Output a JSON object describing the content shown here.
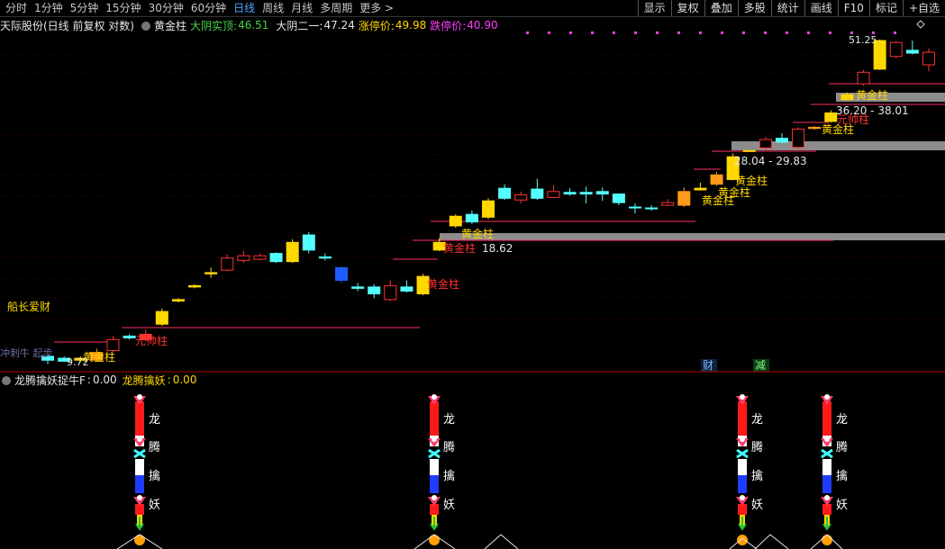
{
  "toolbar": {
    "period_tabs": [
      {
        "label": "分时"
      },
      {
        "label": "1分钟"
      },
      {
        "label": "5分钟"
      },
      {
        "label": "15分钟"
      },
      {
        "label": "30分钟"
      },
      {
        "label": "60分钟"
      },
      {
        "label": "日线"
      },
      {
        "label": "周线"
      },
      {
        "label": "月线"
      },
      {
        "label": "多周期"
      },
      {
        "label": "更多 >"
      }
    ],
    "active_tab": "日线",
    "right_tools": [
      {
        "label": "显示"
      },
      {
        "label": "复权"
      },
      {
        "label": "叠加"
      },
      {
        "label": "多股"
      },
      {
        "label": "统计"
      },
      {
        "label": "画线"
      },
      {
        "label": "F10"
      },
      {
        "label": "标记"
      },
      {
        "label": "+自选"
      }
    ]
  },
  "legend": {
    "stock": "天际股份(日线 前复权 对数)",
    "indicator": "黄金柱",
    "big_yin_label": "大阴实顶:",
    "big_yin_value": "46.51",
    "big_yin2_label": "大阴二一:",
    "big_yin2_value": "47.24",
    "limit_up_label": "涨停价:",
    "limit_up_value": "49.98",
    "limit_down_label": "跌停价:",
    "limit_down_value": "40.90"
  },
  "chart_labels": {
    "captain": "船长爱财",
    "golden": "黄金柱",
    "marshal": "元帅柱",
    "low_value": "9.72",
    "high_value": "51.25",
    "range1": "18.62",
    "range2": "28.04 - 29.83",
    "range3": "36.20 - 38.01",
    "cai": "财",
    "jian": "减",
    "left_faded": "冲刺牛 起步"
  },
  "indicator_panel": {
    "name": "龙腾擒妖捉牛F",
    "value_sep": ":",
    "value": "0.00",
    "sub_name": "龙腾擒妖",
    "sub_value": "0.00",
    "chars": [
      "龙",
      "腾",
      "擒",
      "妖"
    ]
  },
  "colors": {
    "up": "#ff3232",
    "down": "#54ffff",
    "golden": "#ffd800",
    "orange": "#ff9a1a",
    "gray_band": "#8c8c8c",
    "blue_candle": "#1f5cff",
    "legend_green": "#46d646",
    "legend_magenta": "#ff3cff"
  },
  "chart_data": {
    "type": "candlestick",
    "scale": "log",
    "candles": [
      {
        "o": 10.0,
        "c": 9.8,
        "h": 10.2,
        "l": 9.6,
        "kind": "down"
      },
      {
        "o": 9.9,
        "c": 9.75,
        "h": 10.0,
        "l": 9.72,
        "kind": "down"
      },
      {
        "o": 9.8,
        "c": 9.9,
        "h": 10.0,
        "l": 9.7,
        "kind": "golden"
      },
      {
        "o": 10.2,
        "c": 9.8,
        "h": 10.4,
        "l": 9.75,
        "kind": "orange"
      },
      {
        "o": 10.3,
        "c": 10.9,
        "h": 11.1,
        "l": 10.2,
        "kind": "up"
      },
      {
        "o": 11.0,
        "c": 11.1,
        "h": 11.2,
        "l": 10.9,
        "kind": "down"
      },
      {
        "o": 11.2,
        "c": 10.9,
        "h": 11.5,
        "l": 10.8,
        "kind": "upfill"
      },
      {
        "o": 11.8,
        "c": 12.6,
        "h": 12.8,
        "l": 11.7,
        "kind": "golden"
      },
      {
        "o": 13.3,
        "c": 13.4,
        "h": 13.5,
        "l": 13.2,
        "kind": "golden"
      },
      {
        "o": 14.3,
        "c": 14.4,
        "h": 14.5,
        "l": 14.2,
        "kind": "golden"
      },
      {
        "o": 15.3,
        "c": 15.4,
        "h": 15.8,
        "l": 15.0,
        "kind": "golden"
      },
      {
        "o": 15.6,
        "c": 16.6,
        "h": 16.9,
        "l": 15.5,
        "kind": "up"
      },
      {
        "o": 16.4,
        "c": 16.8,
        "h": 17.2,
        "l": 16.2,
        "kind": "up"
      },
      {
        "o": 16.5,
        "c": 16.8,
        "h": 17.0,
        "l": 16.4,
        "kind": "up"
      },
      {
        "o": 17.0,
        "c": 16.3,
        "h": 17.1,
        "l": 16.2,
        "kind": "down"
      },
      {
        "o": 16.3,
        "c": 18.0,
        "h": 18.3,
        "l": 16.2,
        "kind": "golden"
      },
      {
        "o": 18.7,
        "c": 17.3,
        "h": 19.0,
        "l": 17.0,
        "kind": "down"
      },
      {
        "o": 16.7,
        "c": 16.6,
        "h": 17.0,
        "l": 16.4,
        "kind": "down"
      },
      {
        "o": 15.8,
        "c": 14.8,
        "h": 15.9,
        "l": 14.6,
        "kind": "blue"
      },
      {
        "o": 14.3,
        "c": 14.2,
        "h": 14.6,
        "l": 14.0,
        "kind": "down"
      },
      {
        "o": 14.3,
        "c": 13.8,
        "h": 14.5,
        "l": 13.5,
        "kind": "down"
      },
      {
        "o": 13.4,
        "c": 14.4,
        "h": 14.8,
        "l": 13.3,
        "kind": "up"
      },
      {
        "o": 14.3,
        "c": 14.0,
        "h": 14.8,
        "l": 13.9,
        "kind": "down"
      },
      {
        "o": 13.8,
        "c": 15.1,
        "h": 15.3,
        "l": 13.7,
        "kind": "golden"
      },
      {
        "o": 17.3,
        "c": 18.0,
        "h": 18.4,
        "l": 17.2,
        "kind": "golden"
      },
      {
        "o": 19.6,
        "c": 20.6,
        "h": 20.8,
        "l": 19.4,
        "kind": "golden"
      },
      {
        "o": 20.0,
        "c": 20.8,
        "h": 21.2,
        "l": 19.8,
        "kind": "down"
      },
      {
        "o": 20.5,
        "c": 22.3,
        "h": 22.6,
        "l": 20.3,
        "kind": "golden"
      },
      {
        "o": 23.8,
        "c": 22.6,
        "h": 24.3,
        "l": 22.4,
        "kind": "down"
      },
      {
        "o": 22.4,
        "c": 23.0,
        "h": 23.4,
        "l": 22.0,
        "kind": "up"
      },
      {
        "o": 23.7,
        "c": 22.6,
        "h": 25.0,
        "l": 22.4,
        "kind": "down"
      },
      {
        "o": 22.7,
        "c": 23.4,
        "h": 24.2,
        "l": 22.6,
        "kind": "up"
      },
      {
        "o": 23.3,
        "c": 23.1,
        "h": 23.8,
        "l": 22.9,
        "kind": "down"
      },
      {
        "o": 23.3,
        "c": 23.1,
        "h": 24.0,
        "l": 22.0,
        "kind": "down"
      },
      {
        "o": 23.4,
        "c": 23.1,
        "h": 23.9,
        "l": 22.3,
        "kind": "down"
      },
      {
        "o": 23.1,
        "c": 22.1,
        "h": 23.2,
        "l": 21.8,
        "kind": "down"
      },
      {
        "o": 21.6,
        "c": 21.5,
        "h": 22.0,
        "l": 20.9,
        "kind": "down"
      },
      {
        "o": 21.5,
        "c": 21.4,
        "h": 21.8,
        "l": 21.2,
        "kind": "down"
      },
      {
        "o": 21.8,
        "c": 22.1,
        "h": 22.5,
        "l": 21.7,
        "kind": "up"
      },
      {
        "o": 21.8,
        "c": 23.4,
        "h": 23.9,
        "l": 21.6,
        "kind": "orange"
      },
      {
        "o": 23.6,
        "c": 23.8,
        "h": 24.5,
        "l": 23.5,
        "kind": "golden"
      },
      {
        "o": 24.3,
        "c": 25.5,
        "h": 25.9,
        "l": 24.1,
        "kind": "orange"
      },
      {
        "o": 24.9,
        "c": 28.0,
        "h": 28.5,
        "l": 24.8,
        "kind": "golden"
      },
      {
        "o": 28.8,
        "c": 28.9,
        "h": 29.0,
        "l": 28.7,
        "kind": "golden"
      },
      {
        "o": 29.3,
        "c": 30.6,
        "h": 31.0,
        "l": 29.0,
        "kind": "up"
      },
      {
        "o": 30.8,
        "c": 30.2,
        "h": 31.6,
        "l": 30.0,
        "kind": "down"
      },
      {
        "o": 29.4,
        "c": 32.3,
        "h": 32.6,
        "l": 29.2,
        "kind": "up"
      },
      {
        "o": 32.4,
        "c": 32.6,
        "h": 32.8,
        "l": 32.2,
        "kind": "orange"
      },
      {
        "o": 33.6,
        "c": 35.1,
        "h": 35.6,
        "l": 33.4,
        "kind": "golden"
      },
      {
        "o": 37.6,
        "c": 38.6,
        "h": 39.0,
        "l": 37.5,
        "kind": "golden"
      },
      {
        "o": 40.8,
        "c": 43.3,
        "h": 43.8,
        "l": 40.4,
        "kind": "up"
      },
      {
        "o": 44.0,
        "c": 51.0,
        "h": 51.25,
        "l": 43.8,
        "kind": "golden"
      },
      {
        "o": 47.0,
        "c": 50.5,
        "h": 50.9,
        "l": 46.5,
        "kind": "up"
      },
      {
        "o": 48.5,
        "c": 47.8,
        "h": 51.0,
        "l": 47.5,
        "kind": "down"
      },
      {
        "o": 48.0,
        "c": 45.0,
        "h": 49.0,
        "l": 43.5,
        "kind": "up"
      }
    ]
  }
}
